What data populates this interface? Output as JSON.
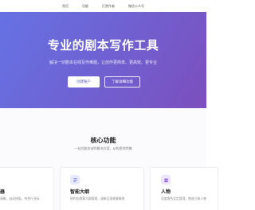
{
  "nav": {
    "items": [
      {
        "label": "首页"
      },
      {
        "label": "功能"
      },
      {
        "label": "打赏作者"
      },
      {
        "label": "微信公众号"
      }
    ]
  },
  "hero": {
    "title": "专业的剧本写作工具",
    "subtitle": "解决一切剧本在线写作难题，让创作更简单、更高效、更专业",
    "primary_button": "创建账户",
    "secondary_button": "了解详细功能"
  },
  "features": {
    "title": "核心功能",
    "subtitle": "一站式剧本创作解决方案，从构思到完稿",
    "cards": [
      {
        "title": "器",
        "desc": "清晰，自动排版，符合行业标",
        "icon": ""
      },
      {
        "title": "智能大纲",
        "desc": "结构化故事大纲管理，清晰呈现故事脉络",
        "icon": "outline-icon"
      },
      {
        "title": "人物",
        "desc": "深度角色设定管理，塑造立体人物",
        "icon": "character-icon"
      }
    ]
  },
  "colors": {
    "hero_gradient_start": "#6672e3",
    "hero_gradient_end": "#7c4fbd",
    "accent": "#5b5bd6"
  }
}
